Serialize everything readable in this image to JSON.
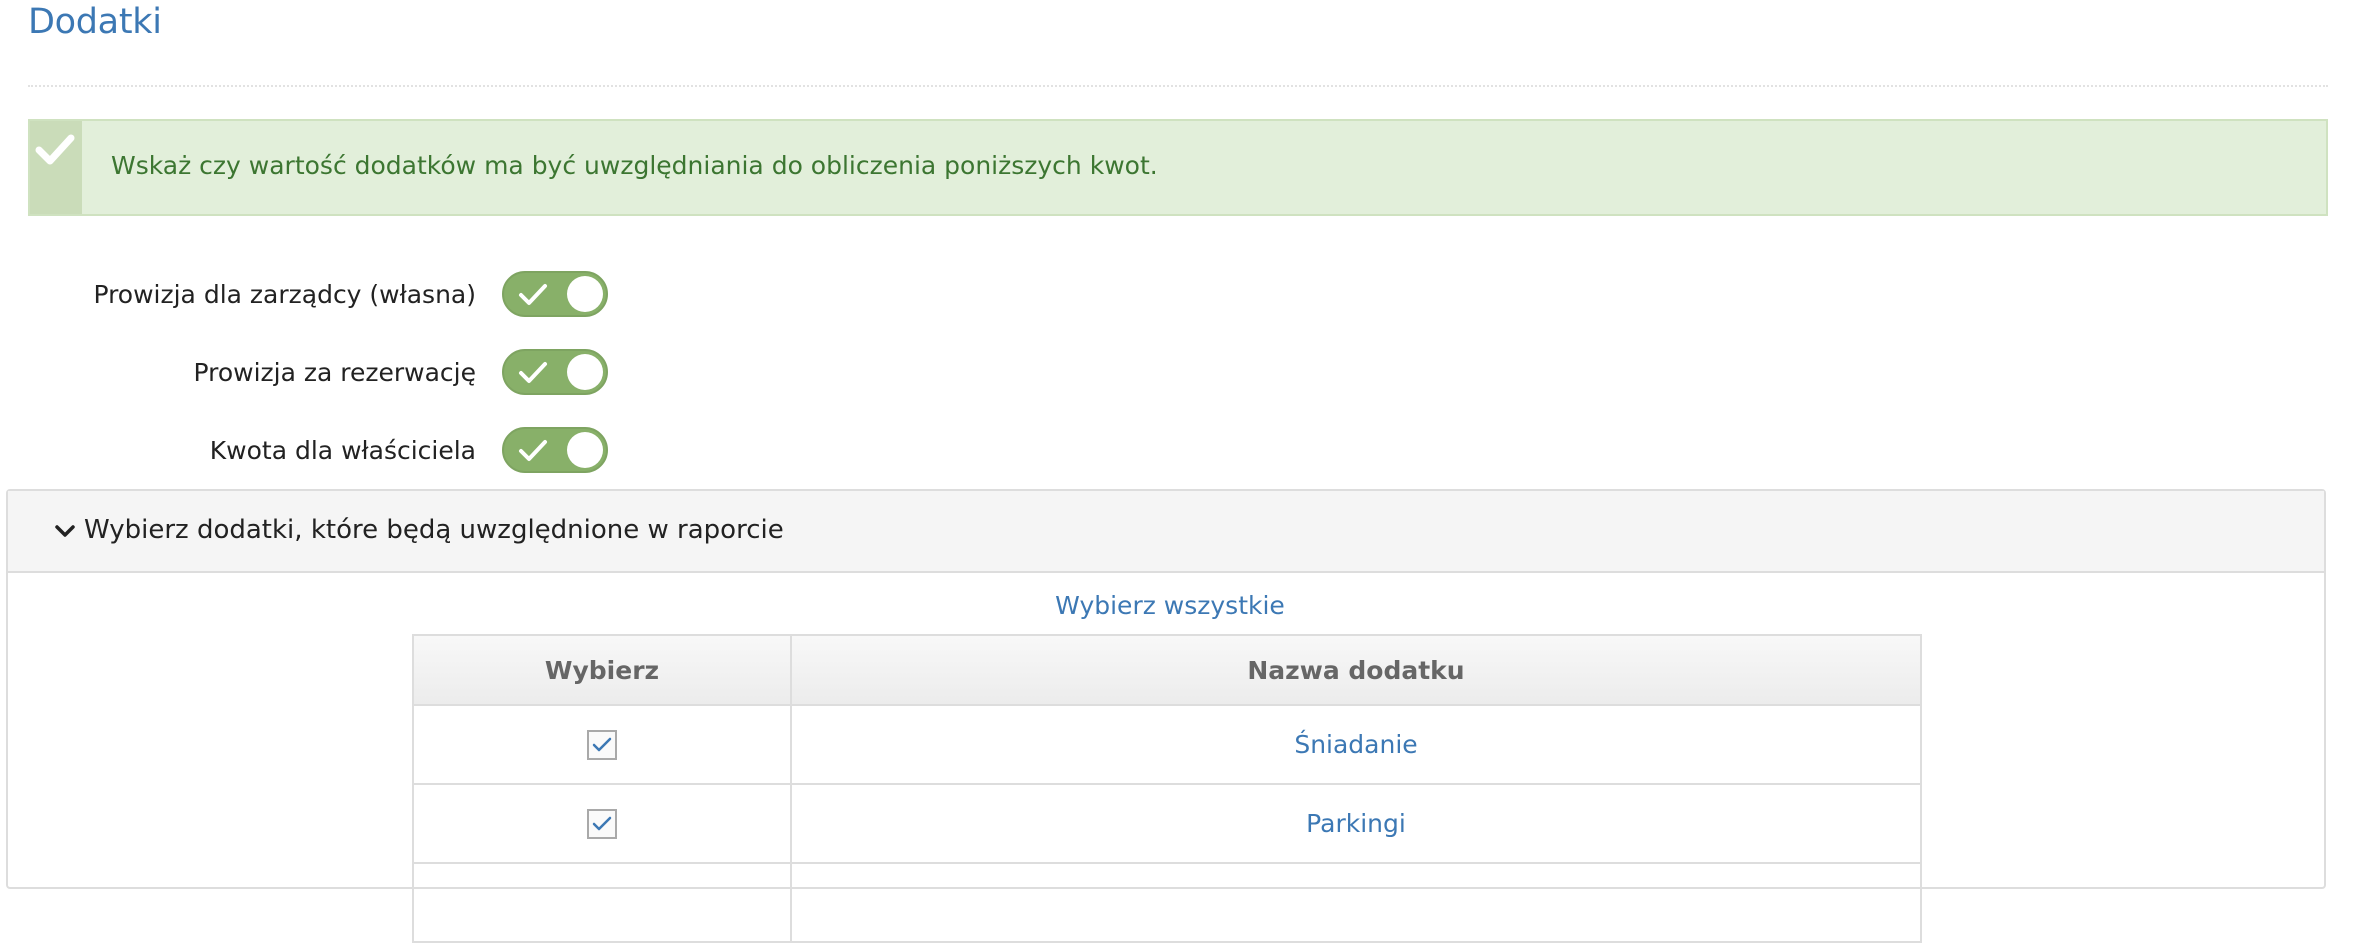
{
  "page": {
    "title": "Dodatki"
  },
  "alert": {
    "icon": "check-icon",
    "text": "Wskaż czy wartość dodatków ma być uwzględniania do obliczenia poniższych kwot.",
    "background": "#e2efda",
    "text_color": "#3c7631"
  },
  "toggles": [
    {
      "label": "Prowizja dla zarządcy (własna)",
      "checked": true
    },
    {
      "label": "Prowizja za rezerwację",
      "checked": true
    },
    {
      "label": "Kwota dla właściciela",
      "checked": true
    }
  ],
  "panel": {
    "icon": "chevron-down-icon",
    "title": "Wybierz dodatki, które będą uwzględnione w raporcie",
    "select_all_label": "Wybierz wszystkie",
    "table": {
      "headers": [
        "Wybierz",
        "Nazwa dodatku"
      ],
      "rows": [
        {
          "checked": true,
          "name": "Śniadanie"
        },
        {
          "checked": true,
          "name": "Parkingi"
        }
      ]
    }
  },
  "colors": {
    "accent": "#3c78b4",
    "toggle_on": "#88b069"
  }
}
